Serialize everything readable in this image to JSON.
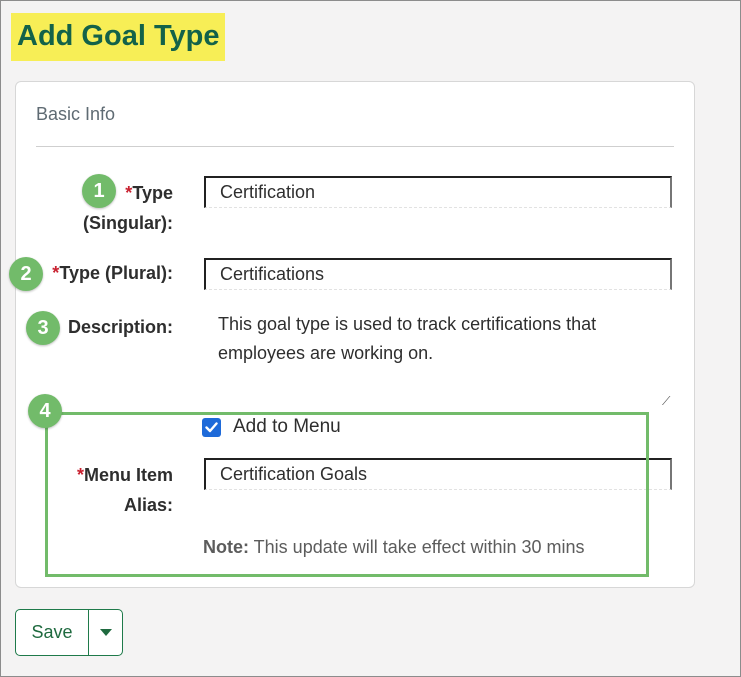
{
  "page": {
    "title": "Add Goal Type"
  },
  "card": {
    "header": "Basic Info"
  },
  "fields": {
    "type_singular": {
      "required_mark": "*",
      "label_line1": "Type",
      "label_line2": "(Singular):",
      "value": "Certification"
    },
    "type_plural": {
      "required_mark": "*",
      "label": "Type (Plural):",
      "value": "Certifications"
    },
    "description": {
      "label": "Description:",
      "value": "This goal type is used to track certifications that employees are working on."
    },
    "add_to_menu": {
      "label": "Add to Menu",
      "checked": true
    },
    "menu_item_alias": {
      "required_mark": "*",
      "label_line1": "Menu Item",
      "label_line2": "Alias:",
      "value": "Certification Goals"
    }
  },
  "note": {
    "prefix": "Note:",
    "text": " This update will take effect within 30 mins"
  },
  "markers": [
    "1",
    "2",
    "3",
    "4"
  ],
  "actions": {
    "save_label": "Save"
  },
  "colors": {
    "title_text": "#136249",
    "title_highlight": "#f7ee56",
    "marker": "#72bb6a",
    "required": "#c8202f",
    "checkbox": "#1e6ad9",
    "save_border": "#1f7a4a"
  }
}
